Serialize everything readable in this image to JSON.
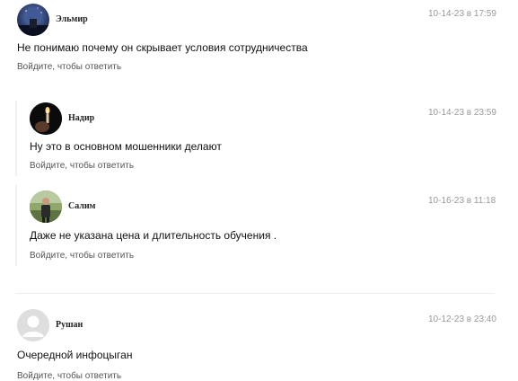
{
  "comments": [
    {
      "author": "Эльмир",
      "date": "10-14-23 в 17:59",
      "text": "Не понимаю почему он скрывает условия сотрудничества",
      "reply_label": "Войдите, чтобы ответить",
      "avatar": "night-sky-avatar"
    },
    {
      "author": "Надир",
      "date": "10-14-23 в 23:59",
      "text": "Ну это в основном мошенники делают",
      "reply_label": "Войдите, чтобы ответить",
      "avatar": "candle-avatar"
    },
    {
      "author": "Салим",
      "date": "10-16-23 в 11:18",
      "text": "Даже не указана цена и длительность обучения .",
      "reply_label": "Войдите, чтобы ответить",
      "avatar": "person-outdoor-avatar"
    },
    {
      "author": "Рушан",
      "date": "10-12-23 в 23:40",
      "text": "Очередной инфоцыган",
      "reply_label": "Войдите, чтобы ответить",
      "avatar": "default-user-avatar"
    }
  ]
}
